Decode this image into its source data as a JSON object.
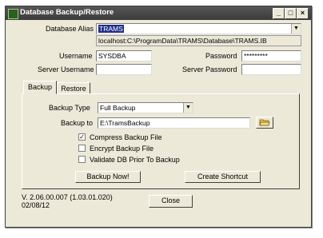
{
  "window": {
    "title": "Database Backup/Restore",
    "minimize": "_",
    "maximize": "□",
    "close": "×"
  },
  "connection": {
    "alias_label": "Database Alias",
    "alias_value": "TRAMS",
    "path": "localhost:C:\\ProgramData\\TRAMS\\Database\\TRAMS.IB",
    "username_label": "Username",
    "username_value": "SYSDBA",
    "password_label": "Password",
    "password_value": "*********",
    "server_username_label": "Server Username",
    "server_username_value": "",
    "server_password_label": "Server Password",
    "server_password_value": ""
  },
  "tabs": [
    {
      "label": "Backup"
    },
    {
      "label": "Restore"
    }
  ],
  "backup": {
    "type_label": "Backup Type",
    "type_value": "Full Backup",
    "to_label": "Backup to",
    "to_value": "E:\\TramsBackup",
    "options": [
      {
        "label": "Compress Backup File",
        "checked": true
      },
      {
        "label": "Encrypt Backup File",
        "checked": false
      },
      {
        "label": "Validate DB Prior To Backup",
        "checked": false
      }
    ],
    "backup_now_label": "Backup Now!",
    "shortcut_label": "Create Shortcut"
  },
  "footer": {
    "version": "V. 2.06.00.007 (1.03.01.020)",
    "date": "02/08/12",
    "close_label": "Close"
  },
  "icons": {
    "app": "database-app-icon",
    "folder": "folder-open-icon",
    "dropdown": "chevron-down-icon",
    "check": "check-icon"
  }
}
